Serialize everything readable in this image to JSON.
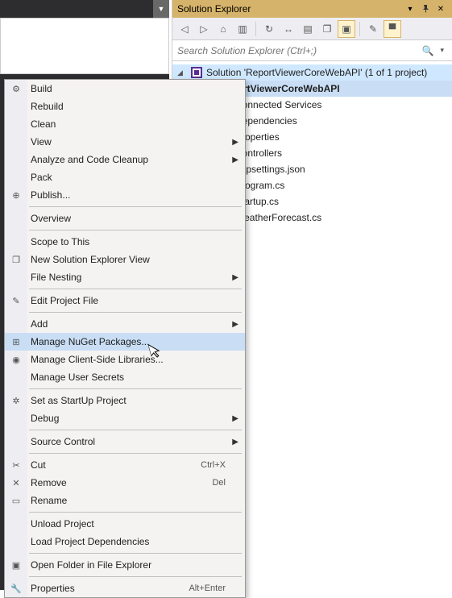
{
  "left_panel": {
    "arrow_glyph": "▼"
  },
  "solution_explorer": {
    "title": "Solution Explorer",
    "search_placeholder": "Search Solution Explorer (Ctrl+;)",
    "title_icons": {
      "menu": "▾",
      "pin": "📌",
      "close": "✕"
    },
    "toolbar": {
      "back": "◁",
      "forward": "▷",
      "home": "⌂",
      "switch_view": "▥",
      "refresh": "↻",
      "collapse": "↔",
      "show_all": "▤",
      "view_code": "❐",
      "add": "▣",
      "properties": "✎",
      "wrench": "▀"
    },
    "tree": {
      "root": "Solution 'ReportViewerCoreWebAPI' (1 of 1 project)",
      "project": "ReportViewerCoreWebAPI",
      "items": [
        "Connected Services",
        "Dependencies",
        "Properties",
        "Controllers",
        "appsettings.json",
        "Program.cs",
        "Startup.cs",
        "WeatherForecast.cs"
      ]
    }
  },
  "context_menu": {
    "groups": [
      [
        {
          "key": "build",
          "label": "Build",
          "icon": "⚙"
        },
        {
          "key": "rebuild",
          "label": "Rebuild"
        },
        {
          "key": "clean",
          "label": "Clean"
        },
        {
          "key": "view",
          "label": "View",
          "submenu": true
        },
        {
          "key": "analyze",
          "label": "Analyze and Code Cleanup",
          "submenu": true
        },
        {
          "key": "pack",
          "label": "Pack"
        },
        {
          "key": "publish",
          "label": "Publish...",
          "icon": "⊕"
        }
      ],
      [
        {
          "key": "overview",
          "label": "Overview"
        }
      ],
      [
        {
          "key": "scope",
          "label": "Scope to This"
        },
        {
          "key": "newview",
          "label": "New Solution Explorer View",
          "icon": "❐"
        },
        {
          "key": "filenest",
          "label": "File Nesting",
          "submenu": true
        }
      ],
      [
        {
          "key": "editproj",
          "label": "Edit Project File",
          "icon": "✎"
        }
      ],
      [
        {
          "key": "add",
          "label": "Add",
          "submenu": true
        },
        {
          "key": "nuget",
          "label": "Manage NuGet Packages...",
          "icon": "⊞",
          "highlight": true
        },
        {
          "key": "clientlib",
          "label": "Manage Client-Side Libraries...",
          "icon": "◉"
        },
        {
          "key": "secrets",
          "label": "Manage User Secrets"
        }
      ],
      [
        {
          "key": "startup",
          "label": "Set as StartUp Project",
          "icon": "✲"
        },
        {
          "key": "debug",
          "label": "Debug",
          "submenu": true
        }
      ],
      [
        {
          "key": "srcctrl",
          "label": "Source Control",
          "submenu": true
        }
      ],
      [
        {
          "key": "cut",
          "label": "Cut",
          "icon": "✂",
          "shortcut": "Ctrl+X"
        },
        {
          "key": "remove",
          "label": "Remove",
          "icon": "✕",
          "shortcut": "Del"
        },
        {
          "key": "rename",
          "label": "Rename",
          "icon": "▭"
        }
      ],
      [
        {
          "key": "unload",
          "label": "Unload Project"
        },
        {
          "key": "loaddeps",
          "label": "Load Project Dependencies"
        }
      ],
      [
        {
          "key": "openfolder",
          "label": "Open Folder in File Explorer",
          "icon": "▣"
        }
      ],
      [
        {
          "key": "properties",
          "label": "Properties",
          "icon": "🔧",
          "shortcut": "Alt+Enter"
        }
      ]
    ]
  }
}
